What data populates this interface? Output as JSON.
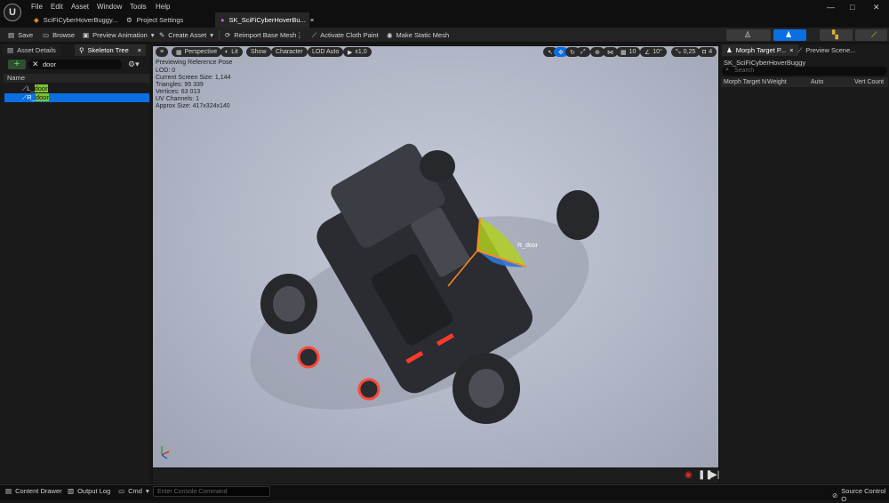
{
  "menu": [
    "File",
    "Edit",
    "Asset",
    "Window",
    "Tools",
    "Help"
  ],
  "tabs": [
    {
      "label": "SciFiCyberHoverBuggy..."
    },
    {
      "label": "Project Settings"
    },
    {
      "label": "SK_SciFiCyberHoverBu..."
    }
  ],
  "toolbar": {
    "save": "Save",
    "browse": "Browse",
    "preview_animation": "Preview Animation",
    "create_asset": "Create Asset",
    "reimport": "Reimport Base Mesh",
    "cloth": "Activate Cloth Paint",
    "static_mesh": "Make Static Mesh"
  },
  "left": {
    "tab1": "Asset Details",
    "tab2": "Skeleton Tree",
    "search_value": "door",
    "name_header": "Name",
    "rows": [
      {
        "prefix": "L_",
        "match": "door"
      },
      {
        "prefix": "R_",
        "match": "door"
      }
    ]
  },
  "viewport": {
    "buttons": {
      "perspective": "Perspective",
      "lit": "Lit",
      "show": "Show",
      "character": "Character",
      "lod": "LOD Auto",
      "speed": "x1,0"
    },
    "right_values": {
      "grid": "10",
      "angle": "10°",
      "scale": "0,25",
      "cam": "4"
    },
    "stats": [
      "Previewing Reference Pose",
      "LOD: 0",
      "Current Screen Size: 1,144",
      "Triangles: 95 339",
      "Vertices: 63 013",
      "UV Channels: 1",
      "Approx Size: 417x324x140"
    ],
    "bone_label": "R_door"
  },
  "right": {
    "tab1": "Morph Target P...",
    "tab2": "Preview Scene...",
    "asset": "SK_SciFiCyberHoverBuggy",
    "search_placeholder": "Search",
    "cols": [
      "Morph Target N",
      "Weight",
      "Auto",
      "Vert Count"
    ]
  },
  "status": {
    "content_drawer": "Content Drawer",
    "output_log": "Output Log",
    "cmd": "Cmd",
    "console_placeholder": "Enter Console Command",
    "source_control": "Source Control O"
  }
}
